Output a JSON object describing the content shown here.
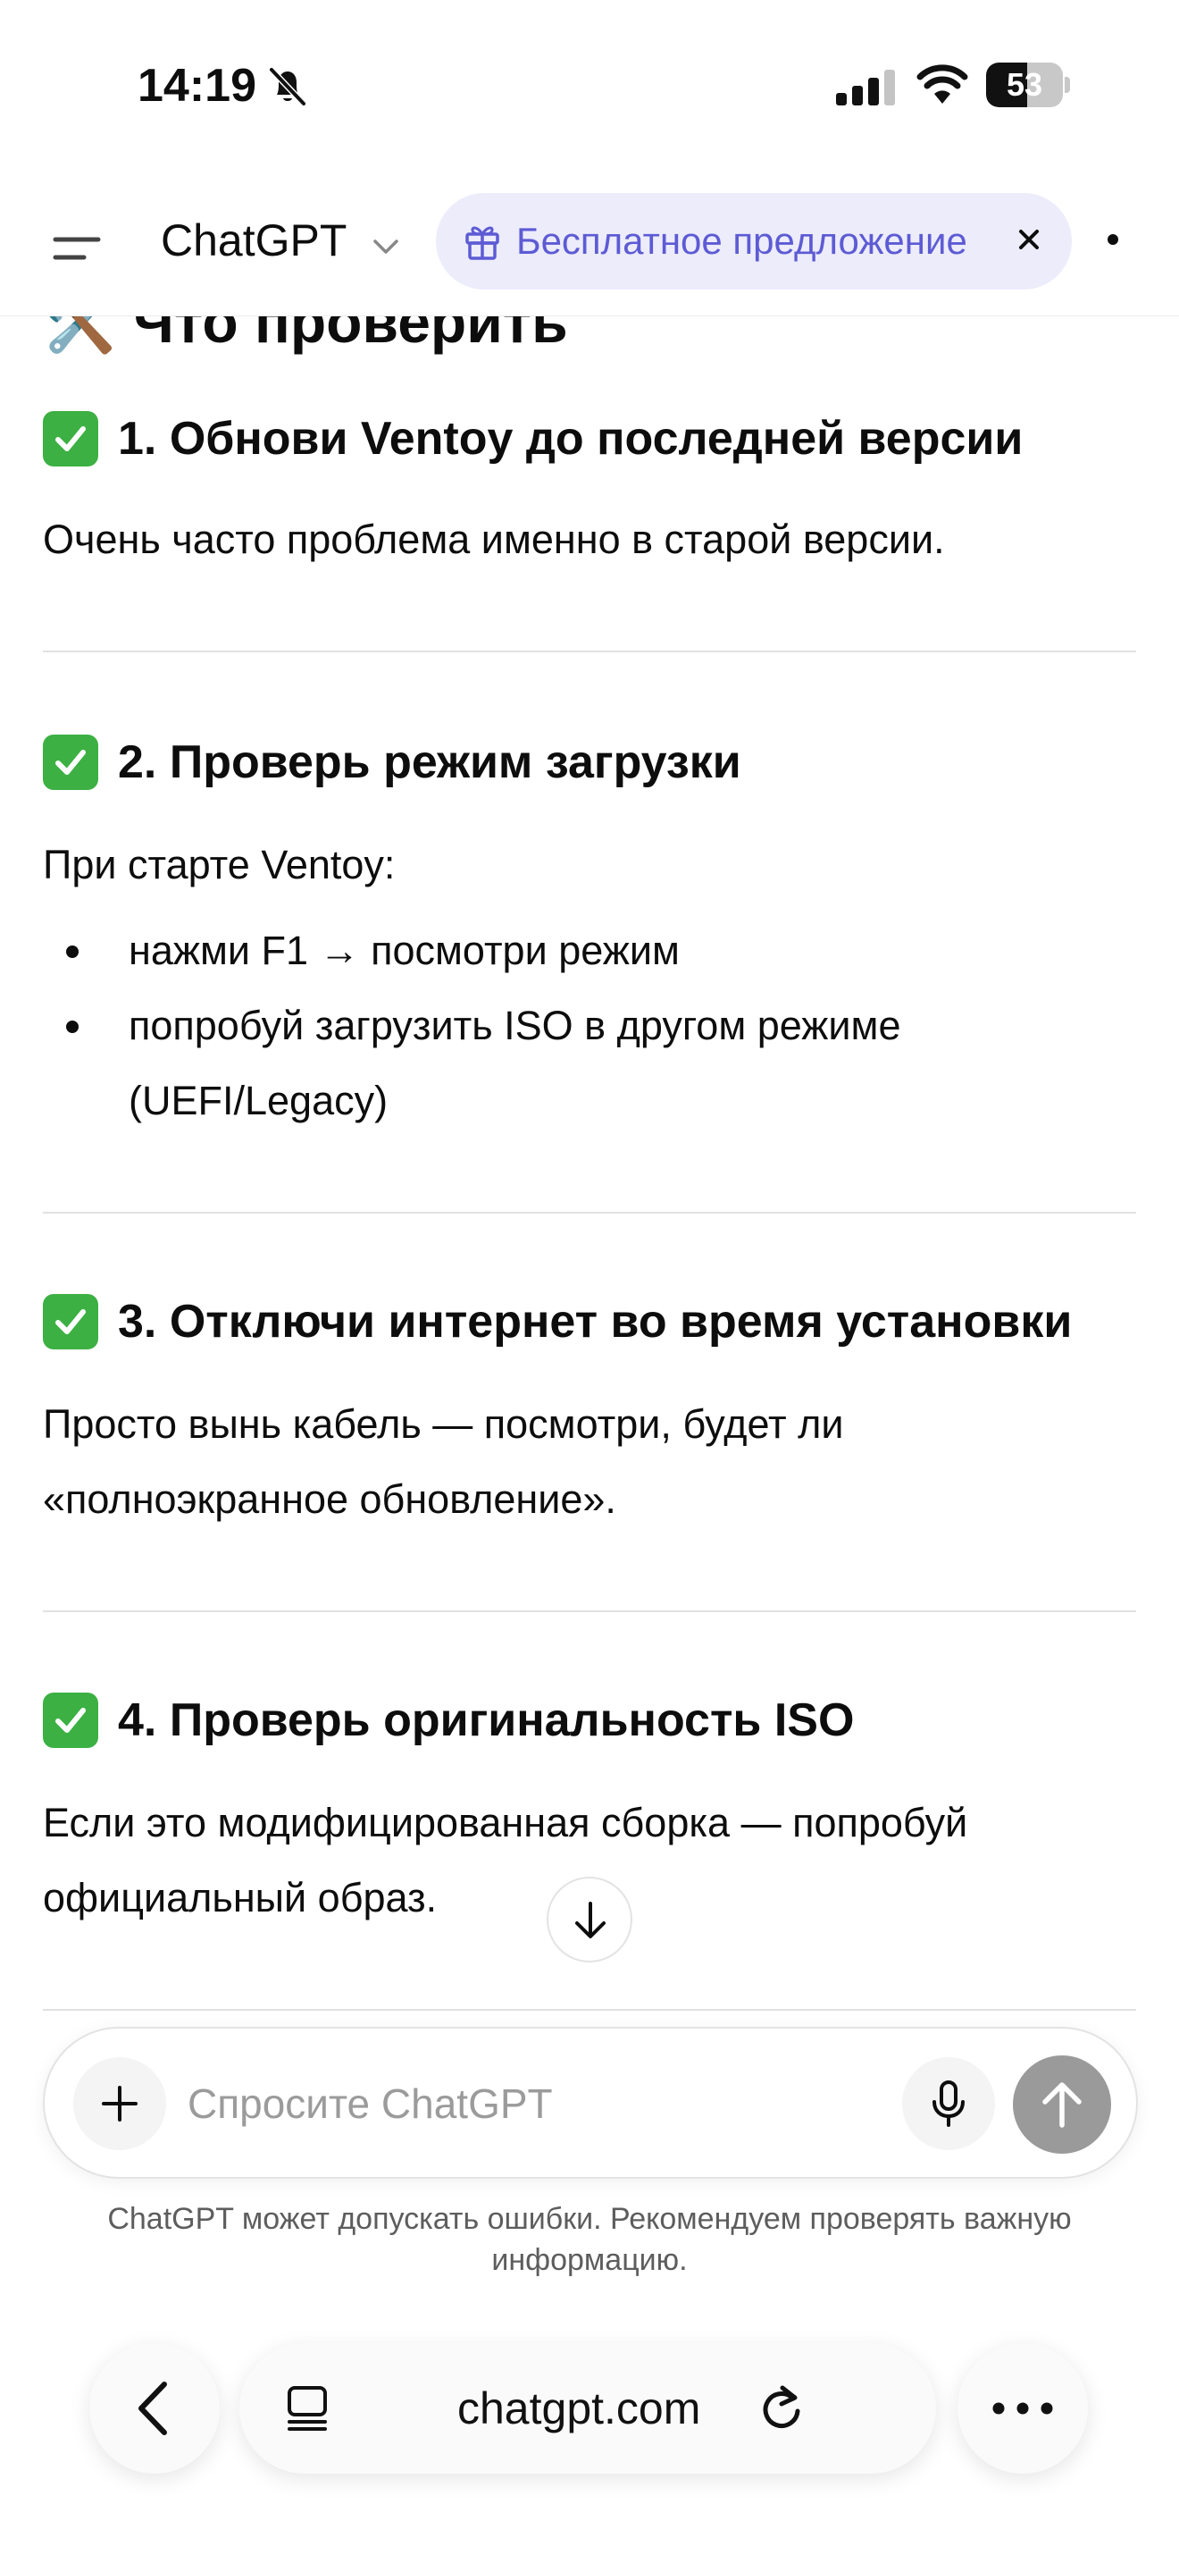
{
  "status_bar": {
    "time": "14:19",
    "battery": "53",
    "battery_level": 0.53,
    "icons": [
      "bell-off-icon",
      "cellular-signal-icon",
      "wifi-icon",
      "battery-icon"
    ]
  },
  "header": {
    "title": "ChatGPT",
    "offer_label": "Бесплатное предложение",
    "icons": [
      "menu-icon",
      "chevron-down-icon",
      "gift-icon",
      "close-icon",
      "more-dot-icon"
    ]
  },
  "content": {
    "partial_heading": "🛠️ Что проверить",
    "sections": [
      {
        "title": "1. Обнови Ventoy до последней версии",
        "text": "Очень часто проблема именно в старой версии."
      },
      {
        "title": "2. Проверь режим загрузки",
        "text": "При старте Ventoy:",
        "bullets": [
          "нажми F1 → посмотри режим",
          "попробуй загрузить ISO в другом режиме (UEFI/Legacy)"
        ]
      },
      {
        "title": "3. Отключи интернет во время установки",
        "text": "Просто вынь кабель — посмотри, будет ли «полноэкранное обновление»."
      },
      {
        "title": "4. Проверь оригинальность ISO",
        "text": "Если это модифицированная сборка — попробуй официальный образ."
      }
    ]
  },
  "composer": {
    "placeholder": "Спросите ChatGPT",
    "icons": [
      "plus-icon",
      "microphone-icon",
      "send-arrow-icon",
      "scroll-down-arrow-icon"
    ]
  },
  "disclaimer": "ChatGPT может допускать ошибки. Рекомендуем проверять важную информацию.",
  "browser_bar": {
    "url": "chatgpt.com",
    "icons": [
      "back-chevron-icon",
      "tabs-icon",
      "reload-icon",
      "more-ellipsis-icon"
    ]
  },
  "colors": {
    "accent": "#5d5bd4",
    "offer_pill_bg": "#ececfb",
    "check_green": "#3cb043",
    "send_button": "#9a9a9a"
  }
}
